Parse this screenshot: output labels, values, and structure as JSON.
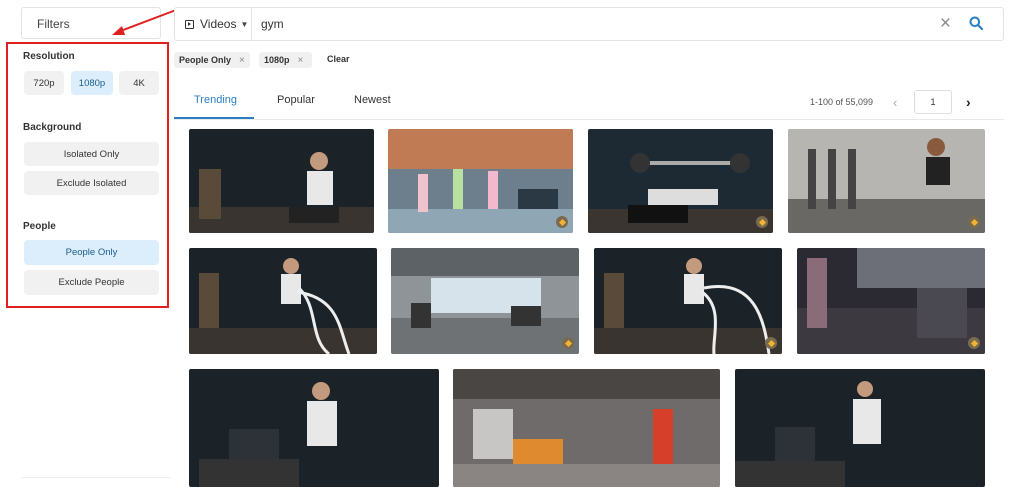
{
  "filters": {
    "title": "Filters"
  },
  "sidebar": {
    "resolution": {
      "title": "Resolution",
      "options": [
        "720p",
        "1080p",
        "4K"
      ],
      "selected": "1080p"
    },
    "background": {
      "title": "Background",
      "options": [
        "Isolated Only",
        "Exclude Isolated"
      ]
    },
    "people": {
      "title": "People",
      "options": [
        "People Only",
        "Exclude People"
      ],
      "selected": "People Only"
    }
  },
  "search": {
    "type_label": "Videos",
    "query": "gym"
  },
  "chips": {
    "items": [
      "People Only",
      "1080p"
    ],
    "clear_label": "Clear"
  },
  "tabs": {
    "items": [
      "Trending",
      "Popular",
      "Newest"
    ],
    "active": "Trending"
  },
  "pagination": {
    "range": "1-100 of 55,099",
    "page": "1"
  },
  "colors": {
    "accent": "#2a7fc4",
    "selected_bg": "#dcedfb",
    "highlight_border": "#e02020"
  }
}
